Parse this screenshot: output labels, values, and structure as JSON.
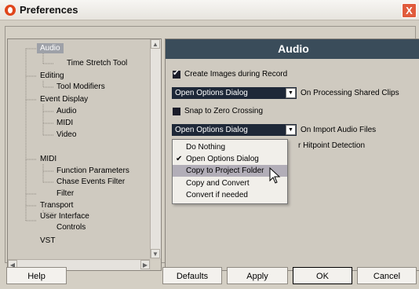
{
  "window": {
    "title": "Preferences",
    "close_glyph": "X"
  },
  "tree": {
    "items": [
      {
        "label": "Audio",
        "selected": true
      },
      {
        "label": "Time Stretch Tool"
      },
      {
        "label": "Editing"
      },
      {
        "label": "Tool Modifiers"
      },
      {
        "label": "Event Display"
      },
      {
        "label": "Audio"
      },
      {
        "label": "MIDI"
      },
      {
        "label": "Video"
      },
      {
        "label": "MIDI"
      },
      {
        "label": "Function Parameters"
      },
      {
        "label": "Chase Events Filter"
      },
      {
        "label": "Filter"
      },
      {
        "label": "Transport"
      },
      {
        "label": "User Interface"
      },
      {
        "label": "Controls"
      },
      {
        "label": "VST"
      }
    ]
  },
  "panel": {
    "header": "Audio",
    "create_images_label": "Create Images during Record",
    "create_images_checked": true,
    "shared_clips_value": "Open Options Dialog",
    "shared_clips_label": "On Processing Shared Clips",
    "snap_zero_label": "Snap to Zero Crossing",
    "snap_zero_checked": false,
    "import_value": "Open Options Dialog",
    "import_label": "On Import Audio Files",
    "hitpoint_label_visible": "r Hitpoint Detection"
  },
  "menu": {
    "items": [
      {
        "label": "Do Nothing"
      },
      {
        "label": "Open Options Dialog",
        "checked": true
      },
      {
        "label": "Copy to Project Folder",
        "highlighted": true
      },
      {
        "label": "Copy and Convert"
      },
      {
        "label": "Convert if needed"
      }
    ]
  },
  "buttons": {
    "help": "Help",
    "defaults": "Defaults",
    "apply": "Apply",
    "ok": "OK",
    "cancel": "Cancel"
  },
  "colors": {
    "header_bg": "#3a4c5a",
    "dropdown_bg": "#1e2838",
    "close_btn": "#e05b3c",
    "logo": "#e0461c",
    "menu_highlight": "#b2aeb8"
  },
  "icons": [
    "cubase-logo-icon",
    "close-icon",
    "dropdown-arrow-icon",
    "scroll-up-icon",
    "scroll-down-icon",
    "scroll-left-icon",
    "scroll-right-icon",
    "checkmark-icon",
    "mouse-pointer-icon"
  ]
}
